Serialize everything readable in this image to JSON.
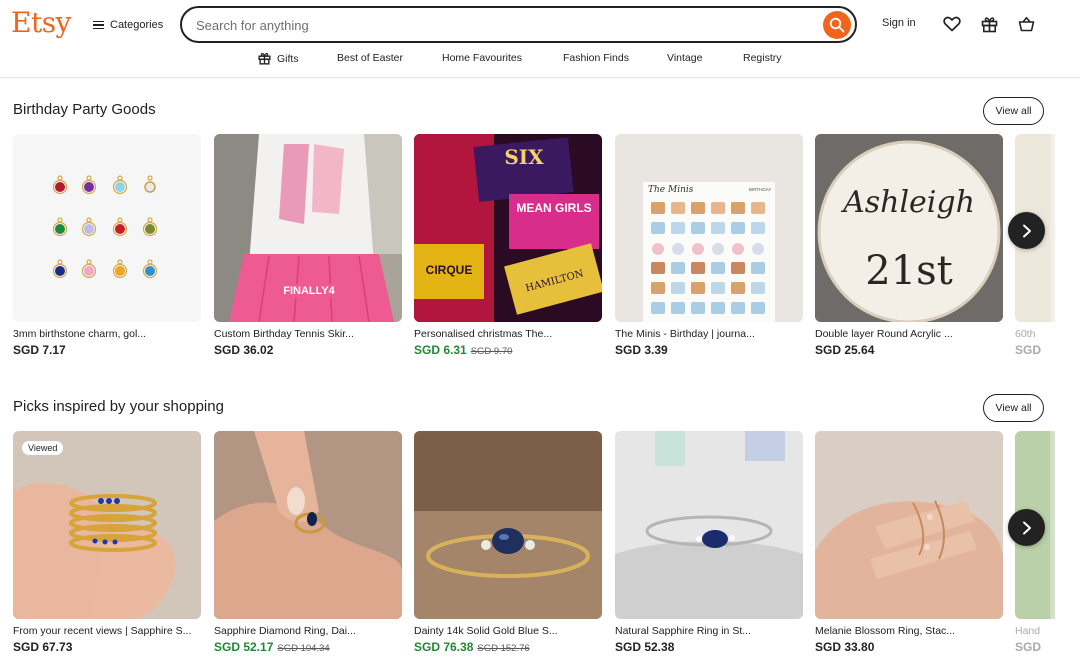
{
  "header": {
    "logo": "Etsy",
    "categories_label": "Categories",
    "search_placeholder": "Search for anything",
    "signin_label": "Sign in"
  },
  "nav": [
    {
      "label": "Gifts",
      "icon": "gift-icon"
    },
    {
      "label": "Best of Easter"
    },
    {
      "label": "Home Favourites"
    },
    {
      "label": "Fashion Finds"
    },
    {
      "label": "Vintage"
    },
    {
      "label": "Registry"
    }
  ],
  "sections": [
    {
      "title": "Birthday Party Goods",
      "view_all": "View all",
      "cards": [
        {
          "title": "3mm birthstone charm, gol...",
          "price": "SGD 7.17"
        },
        {
          "title": "Custom Birthday Tennis Skir...",
          "price": "SGD 36.02"
        },
        {
          "title": "Personalised christmas The...",
          "price": "SGD 6.31",
          "original": "SGD 9.70"
        },
        {
          "title": "The Minis - Birthday | journa...",
          "price": "SGD 3.39"
        },
        {
          "title": "Double layer Round Acrylic ...",
          "price": "SGD 25.64"
        },
        {
          "title": "60th",
          "price": "SGD"
        }
      ]
    },
    {
      "title": "Picks inspired by your shopping",
      "view_all": "View all",
      "cards": [
        {
          "title": "From your recent views | Sapphire S...",
          "price": "SGD 67.73",
          "badge": "Viewed"
        },
        {
          "title": "Sapphire Diamond Ring, Dai...",
          "price": "SGD 52.17",
          "original": "SGD 104.34"
        },
        {
          "title": "Dainty 14k Solid Gold Blue S...",
          "price": "SGD 76.38",
          "original": "SGD 152.76"
        },
        {
          "title": "Natural Sapphire Ring in St...",
          "price": "SGD 52.38"
        },
        {
          "title": "Melanie Blossom Ring, Stac...",
          "price": "SGD 33.80"
        },
        {
          "title": "Hand",
          "price": "SGD"
        }
      ]
    }
  ],
  "images": {
    "card_1_2_text": "FINALLY4",
    "card_1_3_texts": [
      "SIX",
      "MEAN GIRLS",
      "CIRQUE",
      "HAMILTON"
    ],
    "card_1_4_header": "The Minis",
    "card_1_4_tag": "BIRTHDAY",
    "card_1_5_name": "Ashleigh",
    "card_1_5_age": "21st"
  },
  "colors": {
    "brand": "#f1641e",
    "sale": "#258635"
  }
}
